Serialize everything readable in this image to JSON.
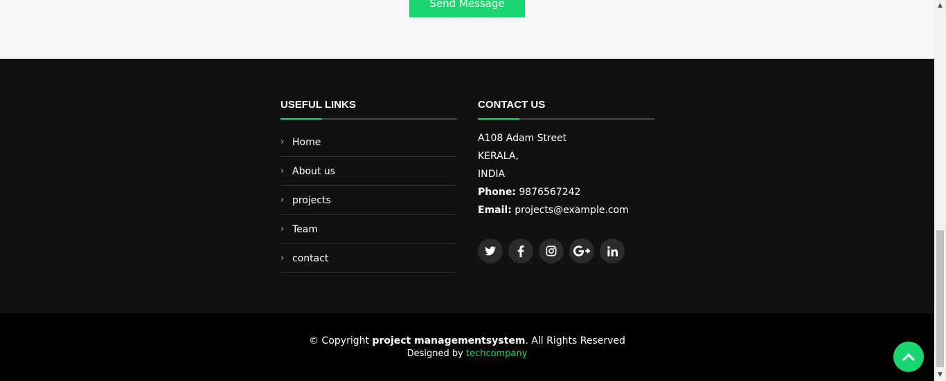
{
  "form": {
    "send_label": "Send Message"
  },
  "footer": {
    "links": {
      "title": "USEFUL LINKS",
      "items": [
        {
          "label": "Home"
        },
        {
          "label": "About us"
        },
        {
          "label": "projects"
        },
        {
          "label": "Team"
        },
        {
          "label": "contact"
        }
      ]
    },
    "contact": {
      "title": "CONTACT US",
      "address_line1": "A108 Adam Street",
      "address_line2": "KERALA,",
      "address_line3": "INDIA",
      "phone_label": "Phone:",
      "phone": "9876567242",
      "email_label": "Email:",
      "email": "projects@example.com"
    },
    "socials": [
      {
        "icon": "twitter-icon"
      },
      {
        "icon": "facebook-icon"
      },
      {
        "icon": "instagram-icon"
      },
      {
        "icon": "google-plus-icon"
      },
      {
        "icon": "linkedin-icon"
      }
    ],
    "copyright_prefix": "© Copyright",
    "copyright_brand": "project managementsystem",
    "copyright_suffix": ". All Rights Reserved",
    "designed_by": "Designed by",
    "designer": "techcompany"
  },
  "colors": {
    "accent": "#1bd66f",
    "footer_bg": "#111111",
    "bottom_bg": "#000000"
  }
}
